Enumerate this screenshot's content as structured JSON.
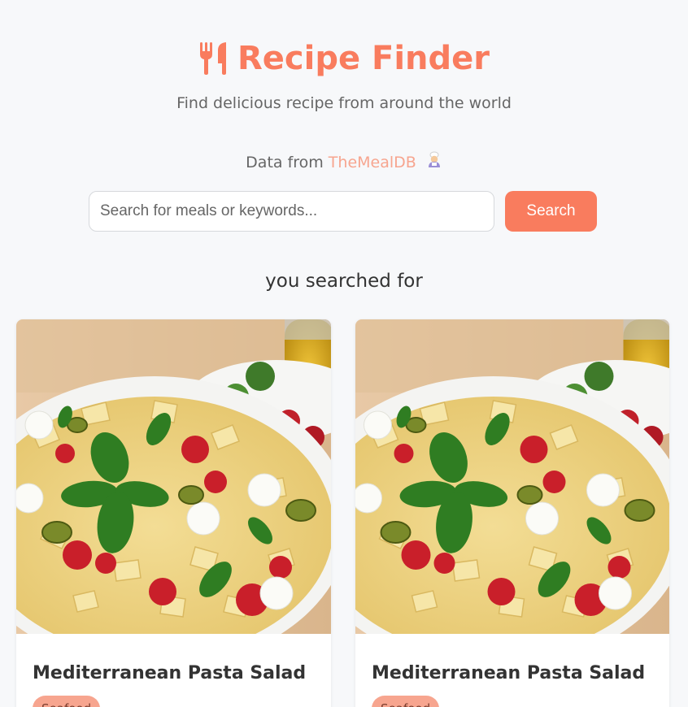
{
  "header": {
    "title": "Recipe Finder",
    "subtitle": "Find delicious recipe from around the world",
    "source_prefix": "Data from",
    "source_link": "TheMealDB"
  },
  "search": {
    "placeholder": "Search for meals or keywords...",
    "value": "",
    "button_label": "Search"
  },
  "results": {
    "heading": "you searched for",
    "cards": [
      {
        "title": "Mediterranean Pasta Salad",
        "category": "Seafood",
        "image": "pasta-salad-photo"
      },
      {
        "title": "Mediterranean Pasta Salad",
        "category": "Seafood",
        "image": "pasta-salad-photo"
      }
    ]
  },
  "icons": {
    "title_icon": "utensils-icon",
    "source_icon": "chef-icon"
  },
  "colors": {
    "accent": "#f97c5e",
    "link": "#f7a58f",
    "background": "#f7f8fa",
    "badge": "#f7a58f"
  }
}
